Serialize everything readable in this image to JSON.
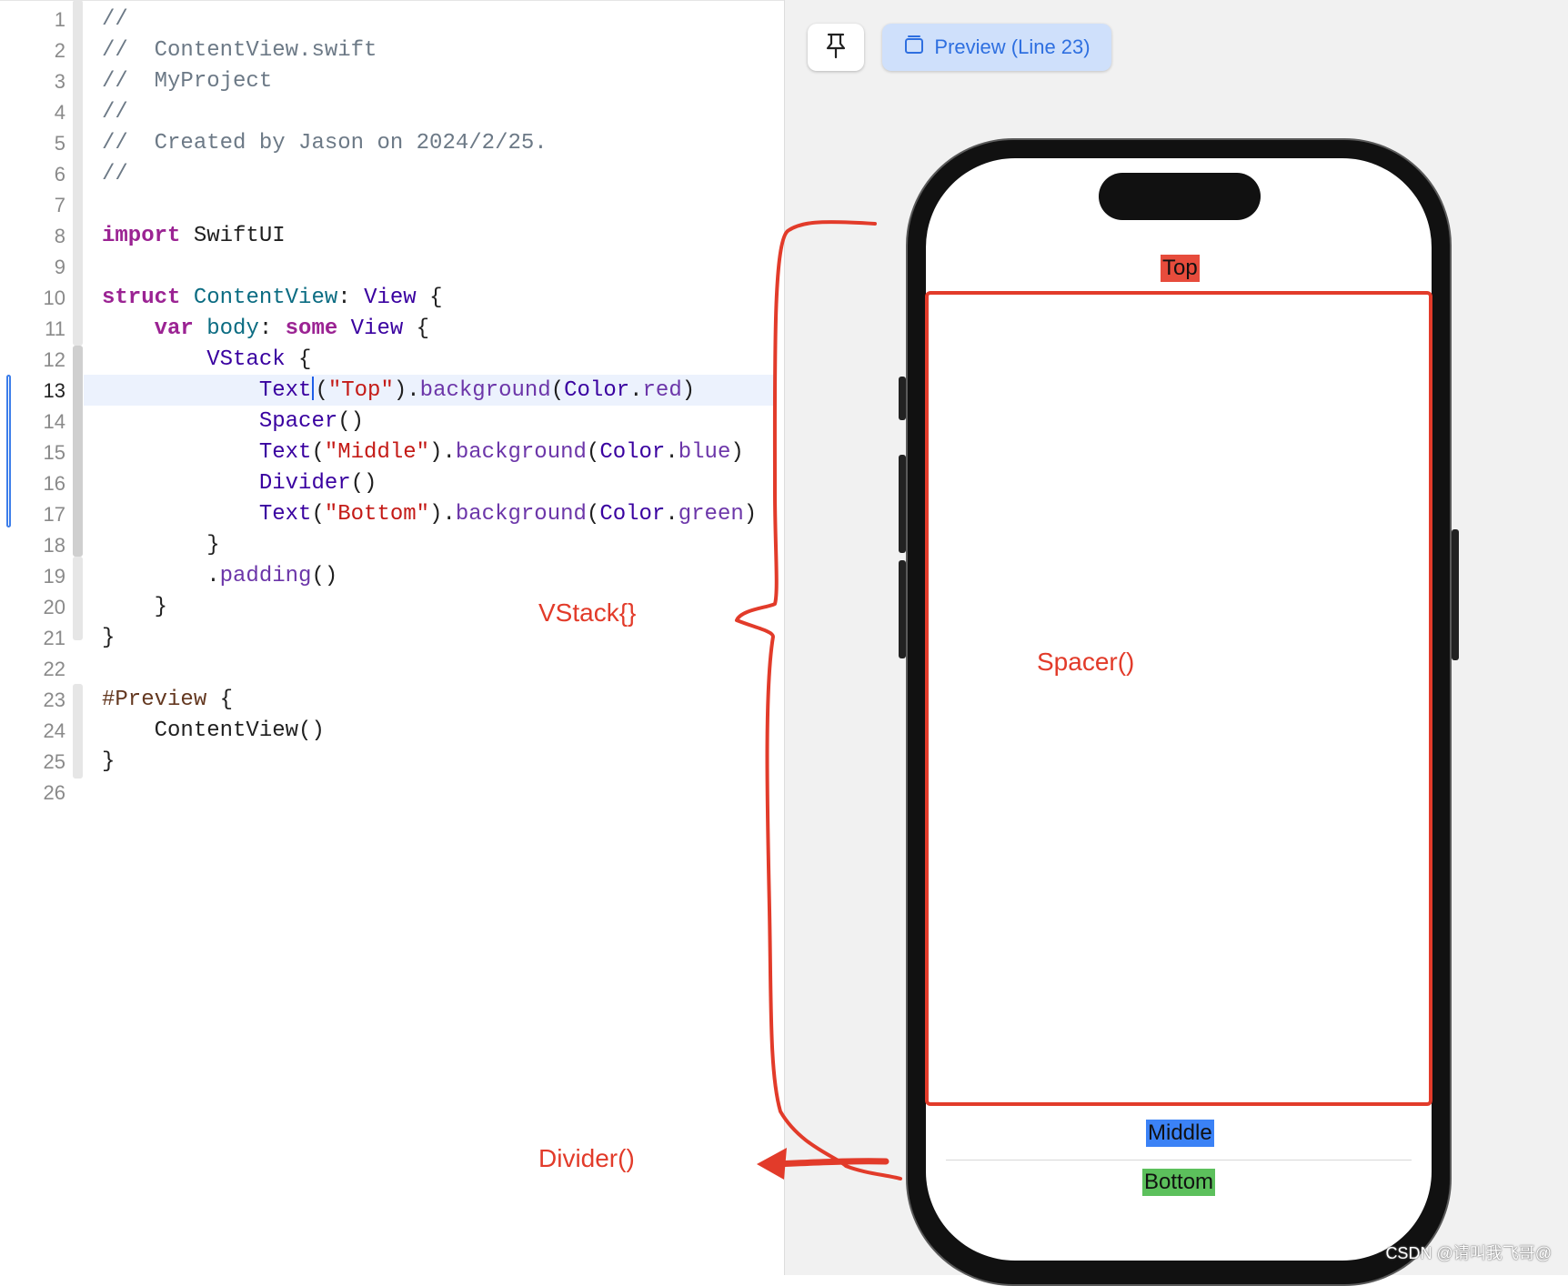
{
  "editor": {
    "current_line": 13,
    "lines": [
      {
        "n": "1",
        "tokens": [
          {
            "t": "//",
            "c": "#6c7986"
          }
        ]
      },
      {
        "n": "2",
        "tokens": [
          {
            "t": "//  ContentView.swift",
            "c": "#6c7986"
          }
        ]
      },
      {
        "n": "3",
        "tokens": [
          {
            "t": "//  MyProject",
            "c": "#6c7986"
          }
        ]
      },
      {
        "n": "4",
        "tokens": [
          {
            "t": "//",
            "c": "#6c7986"
          }
        ]
      },
      {
        "n": "5",
        "tokens": [
          {
            "t": "//  Created by Jason on 2024/2/25.",
            "c": "#6c7986"
          }
        ]
      },
      {
        "n": "6",
        "tokens": [
          {
            "t": "//",
            "c": "#6c7986"
          }
        ]
      },
      {
        "n": "7",
        "tokens": []
      },
      {
        "n": "8",
        "tokens": [
          {
            "t": "import",
            "c": "#9b2393",
            "b": true
          },
          {
            "t": " SwiftUI",
            "c": "#1f1f1f"
          }
        ]
      },
      {
        "n": "9",
        "tokens": []
      },
      {
        "n": "10",
        "tokens": [
          {
            "t": "struct",
            "c": "#9b2393",
            "b": true
          },
          {
            "t": " ",
            "c": "#1f1f1f"
          },
          {
            "t": "ContentView",
            "c": "#0b6c82"
          },
          {
            "t": ": ",
            "c": "#1f1f1f"
          },
          {
            "t": "View",
            "c": "#3900a0"
          },
          {
            "t": " {",
            "c": "#1f1f1f"
          }
        ]
      },
      {
        "n": "11",
        "tokens": [
          {
            "t": "    ",
            "c": "#1f1f1f"
          },
          {
            "t": "var",
            "c": "#9b2393",
            "b": true
          },
          {
            "t": " ",
            "c": "#1f1f1f"
          },
          {
            "t": "body",
            "c": "#0b6c82"
          },
          {
            "t": ": ",
            "c": "#1f1f1f"
          },
          {
            "t": "some",
            "c": "#9b2393",
            "b": true
          },
          {
            "t": " ",
            "c": "#1f1f1f"
          },
          {
            "t": "View",
            "c": "#3900a0"
          },
          {
            "t": " {",
            "c": "#1f1f1f"
          }
        ]
      },
      {
        "n": "12",
        "tokens": [
          {
            "t": "        ",
            "c": "#1f1f1f"
          },
          {
            "t": "VStack",
            "c": "#3900a0"
          },
          {
            "t": " {",
            "c": "#1f1f1f"
          }
        ]
      },
      {
        "n": "13",
        "cursor_after": 2,
        "tokens": [
          {
            "t": "            ",
            "c": "#1f1f1f"
          },
          {
            "t": "Text",
            "c": "#3900a0"
          },
          {
            "t": "(",
            "c": "#1f1f1f"
          },
          {
            "t": "\"Top",
            "c": "#c41a16"
          },
          {
            "t": "\"",
            "c": "#c41a16"
          },
          {
            "t": ").",
            "c": "#1f1f1f"
          },
          {
            "t": "background",
            "c": "#6c36a9"
          },
          {
            "t": "(",
            "c": "#1f1f1f"
          },
          {
            "t": "Color",
            "c": "#3900a0"
          },
          {
            "t": ".",
            "c": "#1f1f1f"
          },
          {
            "t": "red",
            "c": "#6c36a9"
          },
          {
            "t": ")",
            "c": "#1f1f1f"
          }
        ]
      },
      {
        "n": "14",
        "tokens": [
          {
            "t": "            ",
            "c": "#1f1f1f"
          },
          {
            "t": "Spacer",
            "c": "#3900a0"
          },
          {
            "t": "()",
            "c": "#1f1f1f"
          }
        ]
      },
      {
        "n": "15",
        "tokens": [
          {
            "t": "            ",
            "c": "#1f1f1f"
          },
          {
            "t": "Text",
            "c": "#3900a0"
          },
          {
            "t": "(",
            "c": "#1f1f1f"
          },
          {
            "t": "\"Middle\"",
            "c": "#c41a16"
          },
          {
            "t": ").",
            "c": "#1f1f1f"
          },
          {
            "t": "background",
            "c": "#6c36a9"
          },
          {
            "t": "(",
            "c": "#1f1f1f"
          },
          {
            "t": "Color",
            "c": "#3900a0"
          },
          {
            "t": ".",
            "c": "#1f1f1f"
          },
          {
            "t": "blue",
            "c": "#6c36a9"
          },
          {
            "t": ")",
            "c": "#1f1f1f"
          }
        ]
      },
      {
        "n": "16",
        "tokens": [
          {
            "t": "            ",
            "c": "#1f1f1f"
          },
          {
            "t": "Divider",
            "c": "#3900a0"
          },
          {
            "t": "()",
            "c": "#1f1f1f"
          }
        ]
      },
      {
        "n": "17",
        "tokens": [
          {
            "t": "            ",
            "c": "#1f1f1f"
          },
          {
            "t": "Text",
            "c": "#3900a0"
          },
          {
            "t": "(",
            "c": "#1f1f1f"
          },
          {
            "t": "\"Bottom\"",
            "c": "#c41a16"
          },
          {
            "t": ").",
            "c": "#1f1f1f"
          },
          {
            "t": "background",
            "c": "#6c36a9"
          },
          {
            "t": "(",
            "c": "#1f1f1f"
          },
          {
            "t": "Color",
            "c": "#3900a0"
          },
          {
            "t": ".",
            "c": "#1f1f1f"
          },
          {
            "t": "green",
            "c": "#6c36a9"
          },
          {
            "t": ")",
            "c": "#1f1f1f"
          }
        ]
      },
      {
        "n": "18",
        "tokens": [
          {
            "t": "        }",
            "c": "#1f1f1f"
          }
        ]
      },
      {
        "n": "19",
        "tokens": [
          {
            "t": "        .",
            "c": "#1f1f1f"
          },
          {
            "t": "padding",
            "c": "#6c36a9"
          },
          {
            "t": "()",
            "c": "#1f1f1f"
          }
        ]
      },
      {
        "n": "20",
        "tokens": [
          {
            "t": "    }",
            "c": "#1f1f1f"
          }
        ]
      },
      {
        "n": "21",
        "tokens": [
          {
            "t": "}",
            "c": "#1f1f1f"
          }
        ]
      },
      {
        "n": "22",
        "tokens": []
      },
      {
        "n": "23",
        "tokens": [
          {
            "t": "#Preview",
            "c": "#643820"
          },
          {
            "t": " {",
            "c": "#1f1f1f"
          }
        ]
      },
      {
        "n": "24",
        "tokens": [
          {
            "t": "    ContentView()",
            "c": "#1f1f1f"
          }
        ]
      },
      {
        "n": "25",
        "tokens": [
          {
            "t": "}",
            "c": "#1f1f1f"
          }
        ]
      },
      {
        "n": "26",
        "tokens": []
      }
    ]
  },
  "toolbar": {
    "pin_icon": "pin-icon",
    "preview_icon": "preview-window-icon",
    "preview_label": "Preview (Line 23)"
  },
  "canvas": {
    "top_text": "Top",
    "middle_text": "Middle",
    "bottom_text": "Bottom"
  },
  "annotations": {
    "vstack": "VStack{}",
    "spacer": "Spacer()",
    "divider": "Divider()"
  },
  "colors": {
    "annotation": "#e23b2a",
    "top_bg": "#e74c3c",
    "middle_bg": "#3b82f6",
    "bottom_bg": "#5cc05c",
    "accent": "#2e6fe0"
  },
  "watermark": "CSDN @请叫我飞哥@"
}
